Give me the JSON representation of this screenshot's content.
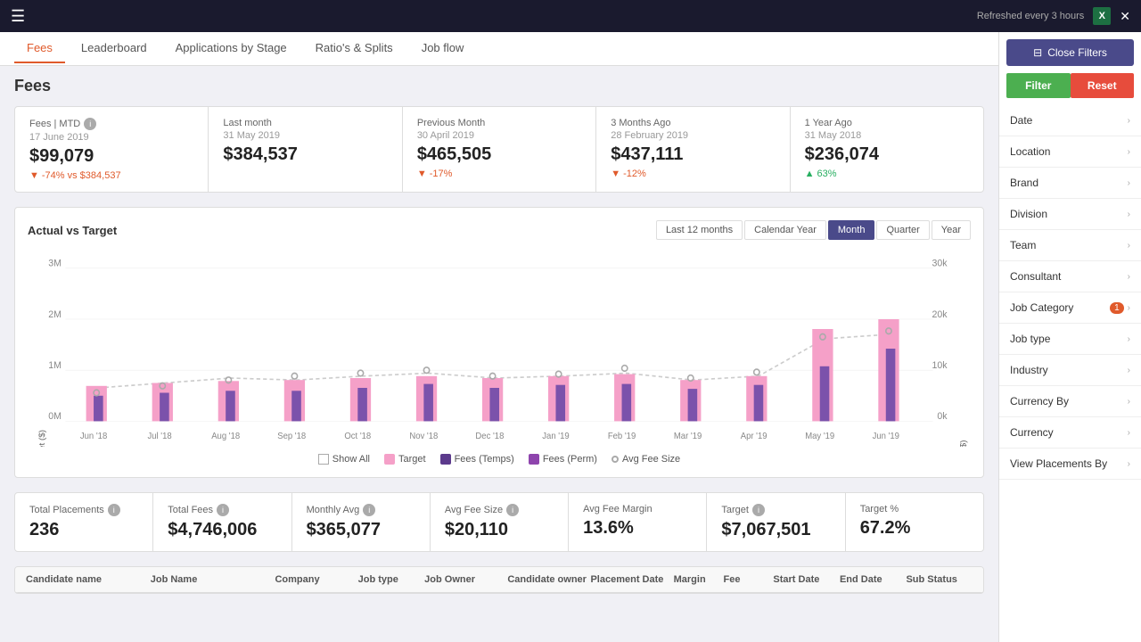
{
  "topbar": {
    "refresh_text": "Refreshed every 3 hours",
    "close_label": "✕"
  },
  "nav": {
    "tabs": [
      "Fees",
      "Leaderboard",
      "Applications by Stage",
      "Ratio's & Splits",
      "Job flow"
    ],
    "active": "Fees"
  },
  "page": {
    "title": "Fees"
  },
  "stats": [
    {
      "label": "Fees | MTD",
      "has_info": true,
      "date": "17 June 2019",
      "value": "$99,079",
      "change": "-74% vs $384,537",
      "change_type": "negative"
    },
    {
      "label": "Last month",
      "has_info": false,
      "date": "31 May 2019",
      "value": "$384,537",
      "change": "",
      "change_type": ""
    },
    {
      "label": "Previous Month",
      "has_info": false,
      "date": "30 April 2019",
      "value": "$465,505",
      "change": "-17%",
      "change_type": "negative"
    },
    {
      "label": "3 Months Ago",
      "has_info": false,
      "date": "28 February 2019",
      "value": "$437,111",
      "change": "-12%",
      "change_type": "negative"
    },
    {
      "label": "1 Year Ago",
      "has_info": false,
      "date": "31 May 2018",
      "value": "$236,074",
      "change": "63%",
      "change_type": "positive"
    }
  ],
  "chart": {
    "title": "Actual vs Target",
    "buttons": [
      "Last 12 months",
      "Calendar Year",
      "Month",
      "Quarter",
      "Year"
    ],
    "active_button": "Month",
    "y_axis_left_label": "Actual vs Target ($)",
    "y_axis_right_label": "Avg Fee Size ($)",
    "y_labels_left": [
      "3M",
      "2M",
      "1M",
      "0M"
    ],
    "y_labels_right": [
      "30k",
      "20k",
      "10k",
      "0k"
    ],
    "x_labels": [
      "Jun '18",
      "Jul '18",
      "Aug '18",
      "Sep '18",
      "Oct '18",
      "Nov '18",
      "Dec '18",
      "Jan '19",
      "Feb '19",
      "Mar '19",
      "Apr '19",
      "May '19",
      "Jun '19"
    ],
    "legend": [
      {
        "label": "Show All",
        "type": "check"
      },
      {
        "label": "Target",
        "type": "box",
        "color": "#f5a0c8"
      },
      {
        "label": "Fees (Temps)",
        "type": "box",
        "color": "#6a4aaa"
      },
      {
        "label": "Fees (Perm)",
        "type": "box",
        "color": "#9b59b6"
      },
      {
        "label": "Avg Fee Size",
        "type": "circle"
      }
    ]
  },
  "bottom_stats": [
    {
      "label": "Total Placements",
      "has_info": true,
      "value": "236"
    },
    {
      "label": "Total Fees",
      "has_info": true,
      "value": "$4,746,006"
    },
    {
      "label": "Monthly Avg",
      "has_info": true,
      "value": "$365,077"
    },
    {
      "label": "Avg Fee Size",
      "has_info": true,
      "value": "$20,110"
    },
    {
      "label": "Avg Fee Margin",
      "has_info": false,
      "value": "13.6%"
    },
    {
      "label": "Target",
      "has_info": true,
      "value": "$7,067,501"
    },
    {
      "label": "Target %",
      "has_info": false,
      "value": "67.2%"
    }
  ],
  "table": {
    "headers": [
      "Candidate name",
      "Job Name",
      "Company",
      "Job type",
      "Job Owner",
      "Candidate owner",
      "Placement Date",
      "Margin",
      "Fee",
      "Start Date",
      "End Date",
      "Sub Status"
    ]
  },
  "sidebar": {
    "close_label": "Close Filters",
    "filter_label": "Filter",
    "reset_label": "Reset",
    "filters": [
      {
        "label": "Date",
        "has_badge": false
      },
      {
        "label": "Location",
        "has_badge": false
      },
      {
        "label": "Brand",
        "has_badge": false
      },
      {
        "label": "Division",
        "has_badge": false
      },
      {
        "label": "Team",
        "has_badge": false
      },
      {
        "label": "Consultant",
        "has_badge": false
      },
      {
        "label": "Job Category",
        "has_badge": true,
        "badge": "1"
      },
      {
        "label": "Job type",
        "has_badge": false
      },
      {
        "label": "Industry",
        "has_badge": false
      },
      {
        "label": "Currency By",
        "has_badge": false
      },
      {
        "label": "Currency",
        "has_badge": false
      },
      {
        "label": "View Placements By",
        "has_badge": false
      }
    ]
  }
}
